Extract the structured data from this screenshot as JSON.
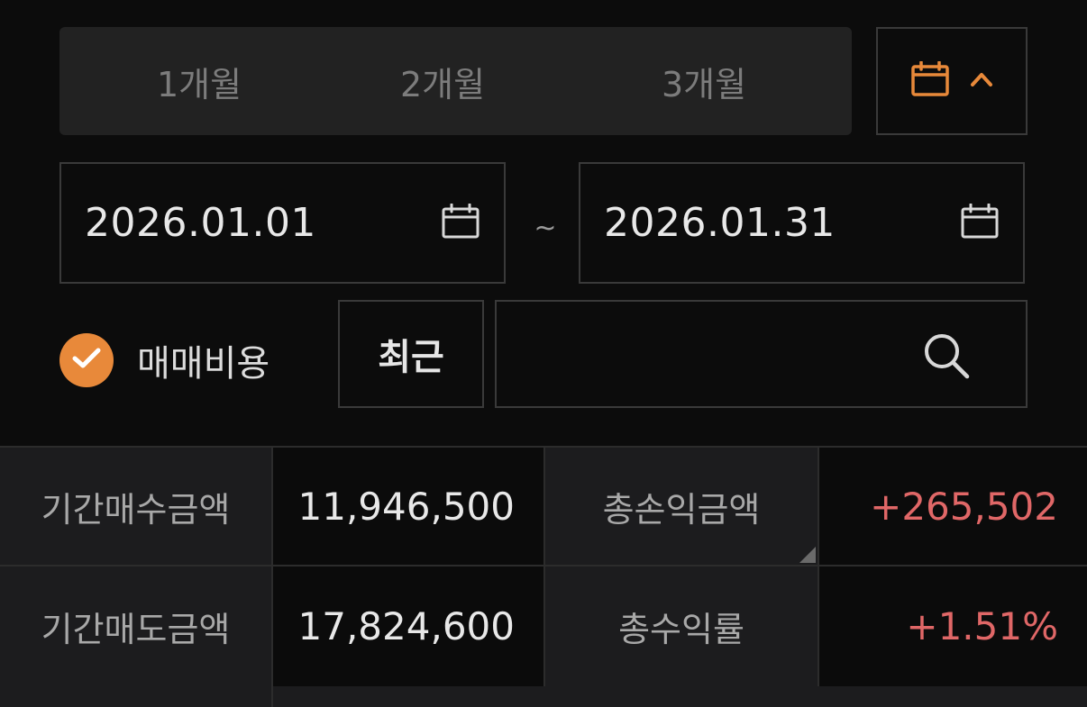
{
  "period_tabs": [
    "1개월",
    "2개월",
    "3개월"
  ],
  "calendar_toggle": {
    "icon": "calendar-icon",
    "chevron": "chevron-up-icon",
    "accent": "#e8893a"
  },
  "date_range": {
    "start": "2026.01.01",
    "separator": "~",
    "end": "2026.01.31",
    "icon": "calendar-icon"
  },
  "fee_option": {
    "label": "매매비용",
    "checked": true,
    "color": "#e8893a"
  },
  "recent_button": "최근",
  "search": {
    "placeholder": "",
    "icon": "search-icon"
  },
  "summary": {
    "row1": {
      "label_left": "기간매수금액",
      "value_left": "11,946,500",
      "label_right": "총손익금액",
      "value_right": "+265,502"
    },
    "row2": {
      "label_left": "기간매도금액",
      "value_left": "17,824,600",
      "label_right": "총수익률",
      "value_right": "+1.51%"
    }
  },
  "colors": {
    "positive": "#e06767",
    "background": "#0c0c0c",
    "panel": "#1c1c1e"
  }
}
